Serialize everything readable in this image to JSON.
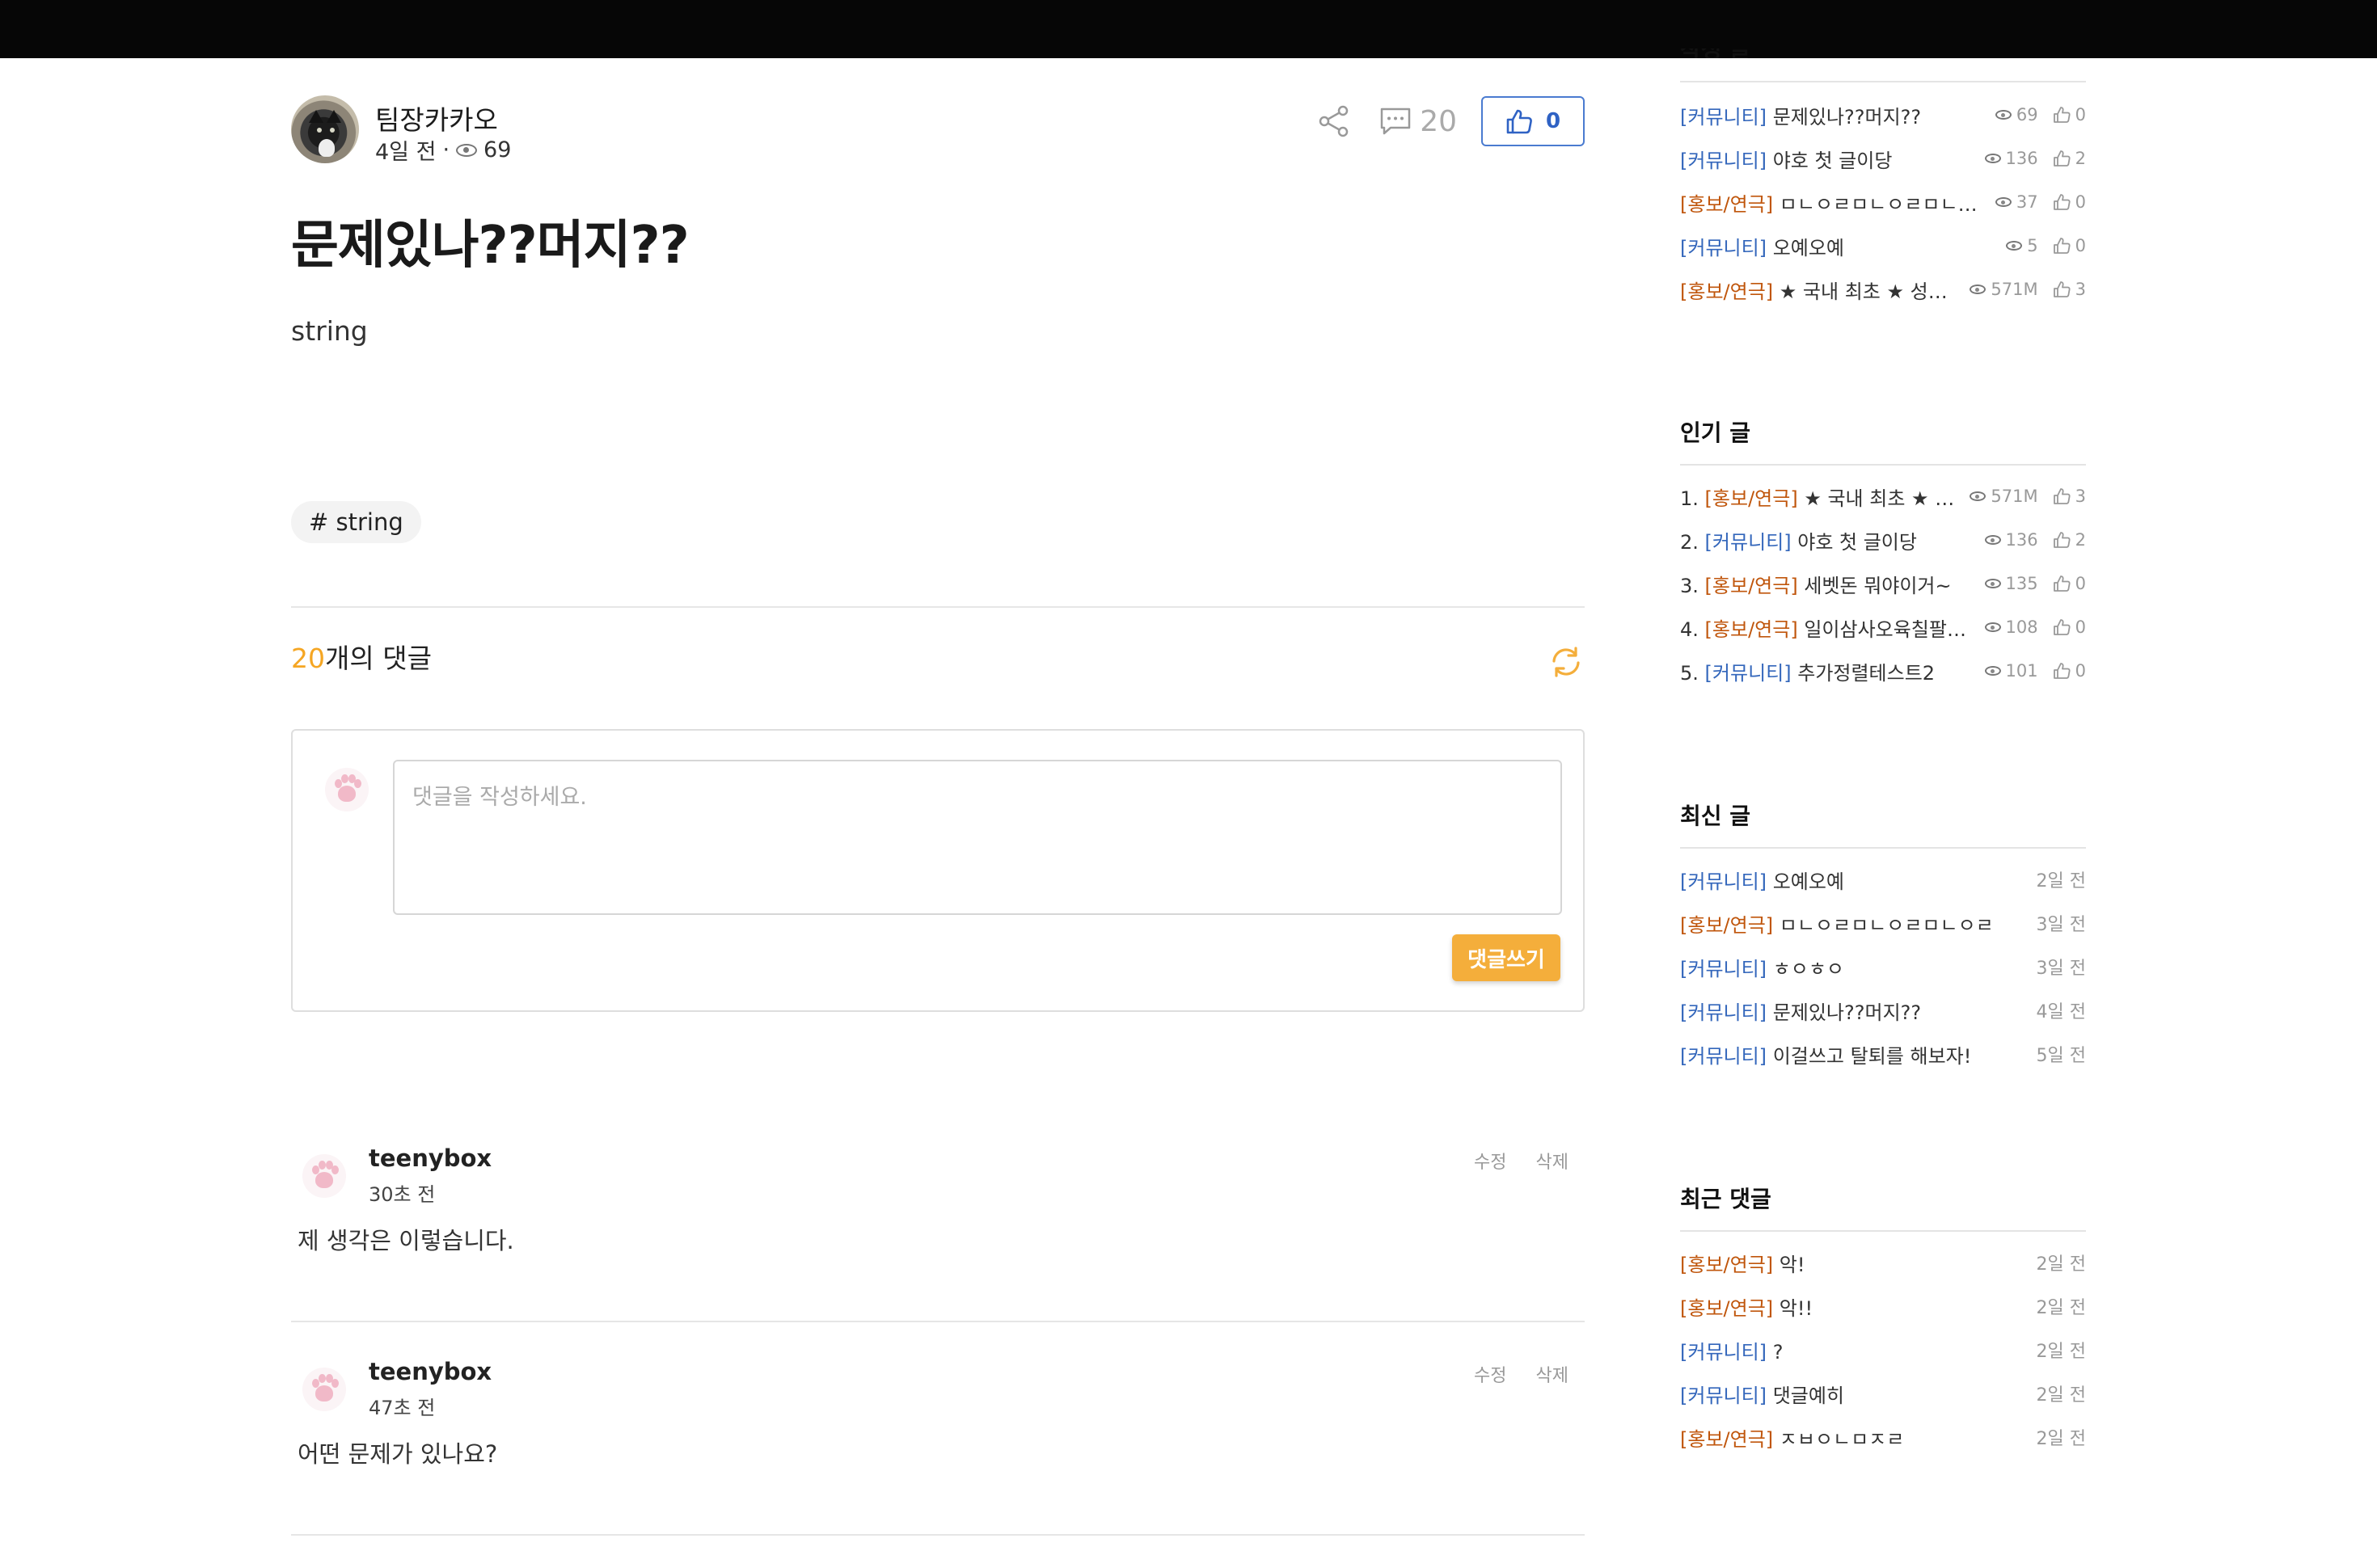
{
  "post": {
    "author": "팀장카카오",
    "time": "4일 전",
    "meta_sep": "·",
    "views": "69",
    "comment_count": "20",
    "likes": "0",
    "title": "문제있나??머지??",
    "body": "string",
    "tag": "# string"
  },
  "comments_section": {
    "count": "20",
    "count_suffix": "개의 댓글",
    "placeholder": "댓글을 작성하세요.",
    "submit_label": "댓글쓰기"
  },
  "comments": [
    {
      "author": "teenybox",
      "time": "30초 전",
      "text": "제 생각은 이렇습니다.",
      "edit": "수정",
      "delete": "삭제"
    },
    {
      "author": "teenybox",
      "time": "47초 전",
      "text": "어떤 문제가 있나요?",
      "edit": "수정",
      "delete": "삭제"
    }
  ],
  "sidebar": {
    "cut_heading": "작성 글",
    "top_list": [
      {
        "category": "[커뮤니티]",
        "type": "community",
        "title": "문제있나??머지??",
        "views": "69",
        "likes": "0"
      },
      {
        "category": "[커뮤니티]",
        "type": "community",
        "title": "야호 첫 글이당",
        "views": "136",
        "likes": "2"
      },
      {
        "category": "[홍보/연극]",
        "type": "promo",
        "title": "ㅁㄴㅇㄹㅁㄴㅇㄹㅁㄴㅇㄹㅁㄴㅇㄹ",
        "views": "37",
        "likes": "0"
      },
      {
        "category": "[커뮤니티]",
        "type": "community",
        "title": "오예오예",
        "views": "5",
        "likes": "0"
      },
      {
        "category": "[홍보/연극]",
        "type": "promo",
        "title": "★ 국내 최초 ★ 성인 연극",
        "views": "571M",
        "likes": "3"
      }
    ],
    "popular": {
      "heading": "인기 글",
      "items": [
        {
          "index": "1.",
          "category": "[홍보/연극]",
          "type": "promo",
          "title": "★ 국내 최초 ★ 성인 연극",
          "views": "571M",
          "likes": "3"
        },
        {
          "index": "2.",
          "category": "[커뮤니티]",
          "type": "community",
          "title": "야호 첫 글이당",
          "views": "136",
          "likes": "2"
        },
        {
          "index": "3.",
          "category": "[홍보/연극]",
          "type": "promo",
          "title": "세벳돈 뭐야이거~",
          "views": "135",
          "likes": "0"
        },
        {
          "index": "4.",
          "category": "[홍보/연극]",
          "type": "promo",
          "title": "일이삼사오육칠팔구십",
          "views": "108",
          "likes": "0"
        },
        {
          "index": "5.",
          "category": "[커뮤니티]",
          "type": "community",
          "title": "추가정렬테스트2",
          "views": "101",
          "likes": "0"
        }
      ]
    },
    "latest": {
      "heading": "최신 글",
      "items": [
        {
          "category": "[커뮤니티]",
          "type": "community",
          "title": "오예오예",
          "date": "2일 전"
        },
        {
          "category": "[홍보/연극]",
          "type": "promo",
          "title": "ㅁㄴㅇㄹㅁㄴㅇㄹㅁㄴㅇㄹ",
          "date": "3일 전"
        },
        {
          "category": "[커뮤니티]",
          "type": "community",
          "title": "ㅎㅇㅎㅇ",
          "date": "3일 전"
        },
        {
          "category": "[커뮤니티]",
          "type": "community",
          "title": "문제있나??머지??",
          "date": "4일 전"
        },
        {
          "category": "[커뮤니티]",
          "type": "community",
          "title": "이걸쓰고 탈퇴를 해보자!",
          "date": "5일 전"
        }
      ]
    },
    "recent_comments": {
      "heading": "최근 댓글",
      "items": [
        {
          "category": "[홍보/연극]",
          "type": "promo",
          "title": "악!",
          "date": "2일 전"
        },
        {
          "category": "[홍보/연극]",
          "type": "promo",
          "title": "악!!",
          "date": "2일 전"
        },
        {
          "category": "[커뮤니티]",
          "type": "community",
          "title": "?",
          "date": "2일 전"
        },
        {
          "category": "[커뮤니티]",
          "type": "community",
          "title": "댓글예히",
          "date": "2일 전"
        },
        {
          "category": "[홍보/연극]",
          "type": "promo",
          "title": "ㅈㅂㅇㄴㅁㅈㄹ",
          "date": "2일 전"
        }
      ]
    }
  },
  "colors": {
    "accent": "#f4ae3b",
    "like_blue": "#2f62c4",
    "community": "#3366bb",
    "promo": "#c0560c"
  }
}
